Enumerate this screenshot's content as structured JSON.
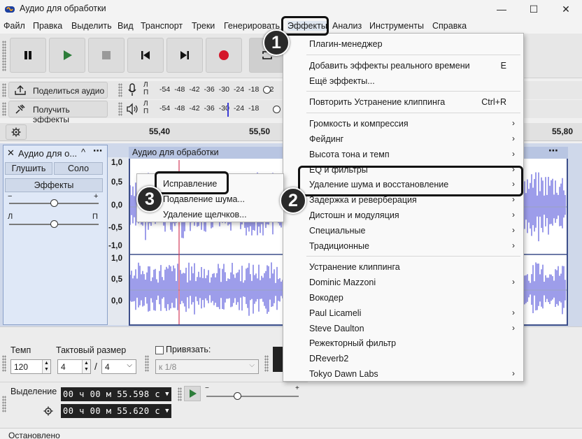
{
  "window": {
    "title": "Аудио для обработки",
    "minimize": "—",
    "maximize": "☐",
    "close": "✕"
  },
  "menubar": [
    "Файл",
    "Правка",
    "Выделить",
    "Вид",
    "Транспорт",
    "Треки",
    "Генерировать",
    "Эффекты",
    "Анализ",
    "Инструменты",
    "Справка"
  ],
  "toolbar": {
    "pause": "pause",
    "play": "play",
    "stop": "stop",
    "skip_start": "skip-start",
    "skip_end": "skip-end",
    "record": "record"
  },
  "share": {
    "share_label": "Поделиться аудио",
    "effects_label": "Получить эффекты"
  },
  "meters": {
    "rec_channels": [
      "Л",
      "П"
    ],
    "ticks": [
      "-54",
      "-48",
      "-42",
      "-36",
      "-30",
      "-24",
      "-18",
      "-12"
    ],
    "play_ticks": [
      "-54",
      "-48",
      "-42",
      "-36",
      "-30",
      "-24",
      "-18"
    ]
  },
  "timeline": {
    "ticks": [
      "55,40",
      "55,50",
      "55,80"
    ]
  },
  "track": {
    "name": "Аудио для о...",
    "mute": "Глушить",
    "solo": "Соло",
    "effects": "Эффекты",
    "gain_minus": "−",
    "gain_plus": "+",
    "pan_left": "Л",
    "pan_right": "П",
    "clip_title": "Аудио для обработки",
    "scale_top": [
      "1,0",
      "0,5",
      "0,0",
      "-0,5",
      "-1,0"
    ],
    "scale_bottom": [
      "1,0",
      "0,5",
      "0,0"
    ]
  },
  "bottom": {
    "tempo_label": "Темп",
    "tempo_value": "120",
    "meter_label": "Тактовый размер",
    "meter_num": "4",
    "meter_sep": "/",
    "meter_den": "4",
    "snap_label": "Привязать:",
    "snap_value": "к 1/8",
    "selection_label": "Выделение",
    "sel_start": "00 ч 00 м 55.598 с",
    "sel_end": "00 ч 00 м 55.620 с"
  },
  "status": "Остановлено",
  "effects_menu": {
    "items": [
      {
        "label": "Плагин-менеджер"
      },
      {
        "sep": true
      },
      {
        "label": "Добавить эффекты реального времени",
        "shortcut": "E"
      },
      {
        "label": "Ещё эффекты..."
      },
      {
        "sep": true
      },
      {
        "label": "Повторить Устранение клиппинга",
        "shortcut": "Ctrl+R"
      },
      {
        "sep": true
      },
      {
        "label": "Громкость и компрессия",
        "submenu": true
      },
      {
        "label": "Фейдинг",
        "submenu": true
      },
      {
        "label": "Высота тона и темп",
        "submenu": true
      },
      {
        "label": "EQ и фильтры",
        "submenu": true
      },
      {
        "label": "Удаление шума и восстановление",
        "submenu": true
      },
      {
        "label": "Задержка и реверберация",
        "submenu": true
      },
      {
        "label": "Дистошн и модуляция",
        "submenu": true
      },
      {
        "label": "Специальные",
        "submenu": true
      },
      {
        "label": "Традиционные",
        "submenu": true
      },
      {
        "sep": true
      },
      {
        "label": "Устранение клиппинга"
      },
      {
        "label": "Dominic Mazzoni",
        "submenu": true
      },
      {
        "label": "Вокодер"
      },
      {
        "label": "Paul Licameli",
        "submenu": true
      },
      {
        "label": "Steve Daulton",
        "submenu": true
      },
      {
        "label": "Режекторный фильтр"
      },
      {
        "label": "DReverb2"
      },
      {
        "label": "Tokyo Dawn Labs",
        "submenu": true
      }
    ]
  },
  "noise_submenu": [
    "Исправление",
    "Подавление шума...",
    "Удаление щелчков..."
  ],
  "badges": [
    "1",
    "2",
    "3"
  ],
  "colors": {
    "waveform": "#3b3bd6",
    "track_border": "#3d4f8a",
    "cursor": "#d23a5a",
    "accent": "#2d7d3a"
  }
}
